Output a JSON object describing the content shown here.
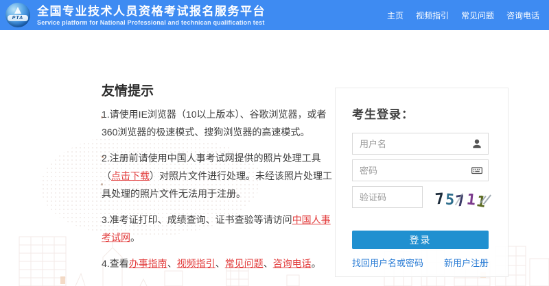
{
  "header": {
    "logo": {
      "text": "PTA"
    },
    "title": "全国专业技术人员资格考试报名服务平台",
    "subtitle": "Service platform for National Professional and technican qualification test",
    "nav": [
      {
        "label": "主页"
      },
      {
        "label": "视频指引"
      },
      {
        "label": "常见问题"
      },
      {
        "label": "咨询电话"
      }
    ]
  },
  "tips": {
    "heading": "友情提示",
    "p1": "1.请使用IE浏览器（10以上版本）、谷歌浏览器，或者360浏览器的极速模式、搜狗浏览器的高速模式。",
    "p2_seg0": "2.注册前请使用中国人事考试网提供的照片处理工具（",
    "p2_link": "点击下载",
    "p2_seg1": "）对照片文件进行处理。未经该照片处理工具处理的照片文件无法用于注册。",
    "p3_seg0": "3.准考证打印、成绩查询、证书查验等请访问",
    "p3_link": "中国人事考试网",
    "p3_seg1": "。",
    "p4_seg0": "4.查看",
    "p4_link1": "办事指南",
    "p4_sep1": "、",
    "p4_link2": "视频指引",
    "p4_sep2": "、",
    "p4_link3": "常见问题",
    "p4_sep3": "、",
    "p4_link4": "咨询电话",
    "p4_seg1": "。"
  },
  "login": {
    "title": "考生登录：",
    "username_placeholder": "用户名",
    "password_placeholder": "密码",
    "captcha_placeholder": "验证码",
    "captcha": {
      "value": "75711",
      "digits": [
        {
          "char": "7",
          "color": "#1c2b3a"
        },
        {
          "char": "5",
          "color": "#2d6d8c"
        },
        {
          "char": "7",
          "color": "#3c3c68"
        },
        {
          "char": "1",
          "color": "#7b3a8c"
        },
        {
          "char": "1",
          "color": "#5c6b22"
        }
      ]
    },
    "login_button": "登录",
    "forgot_link": "找回用户名或密码",
    "register_link": "新用户注册"
  },
  "colors": {
    "header_bg": "#3e8bf2",
    "login_button_bg": "#2090d0",
    "red_link": "#e23c3c",
    "blue_link": "#2a7cd5"
  }
}
